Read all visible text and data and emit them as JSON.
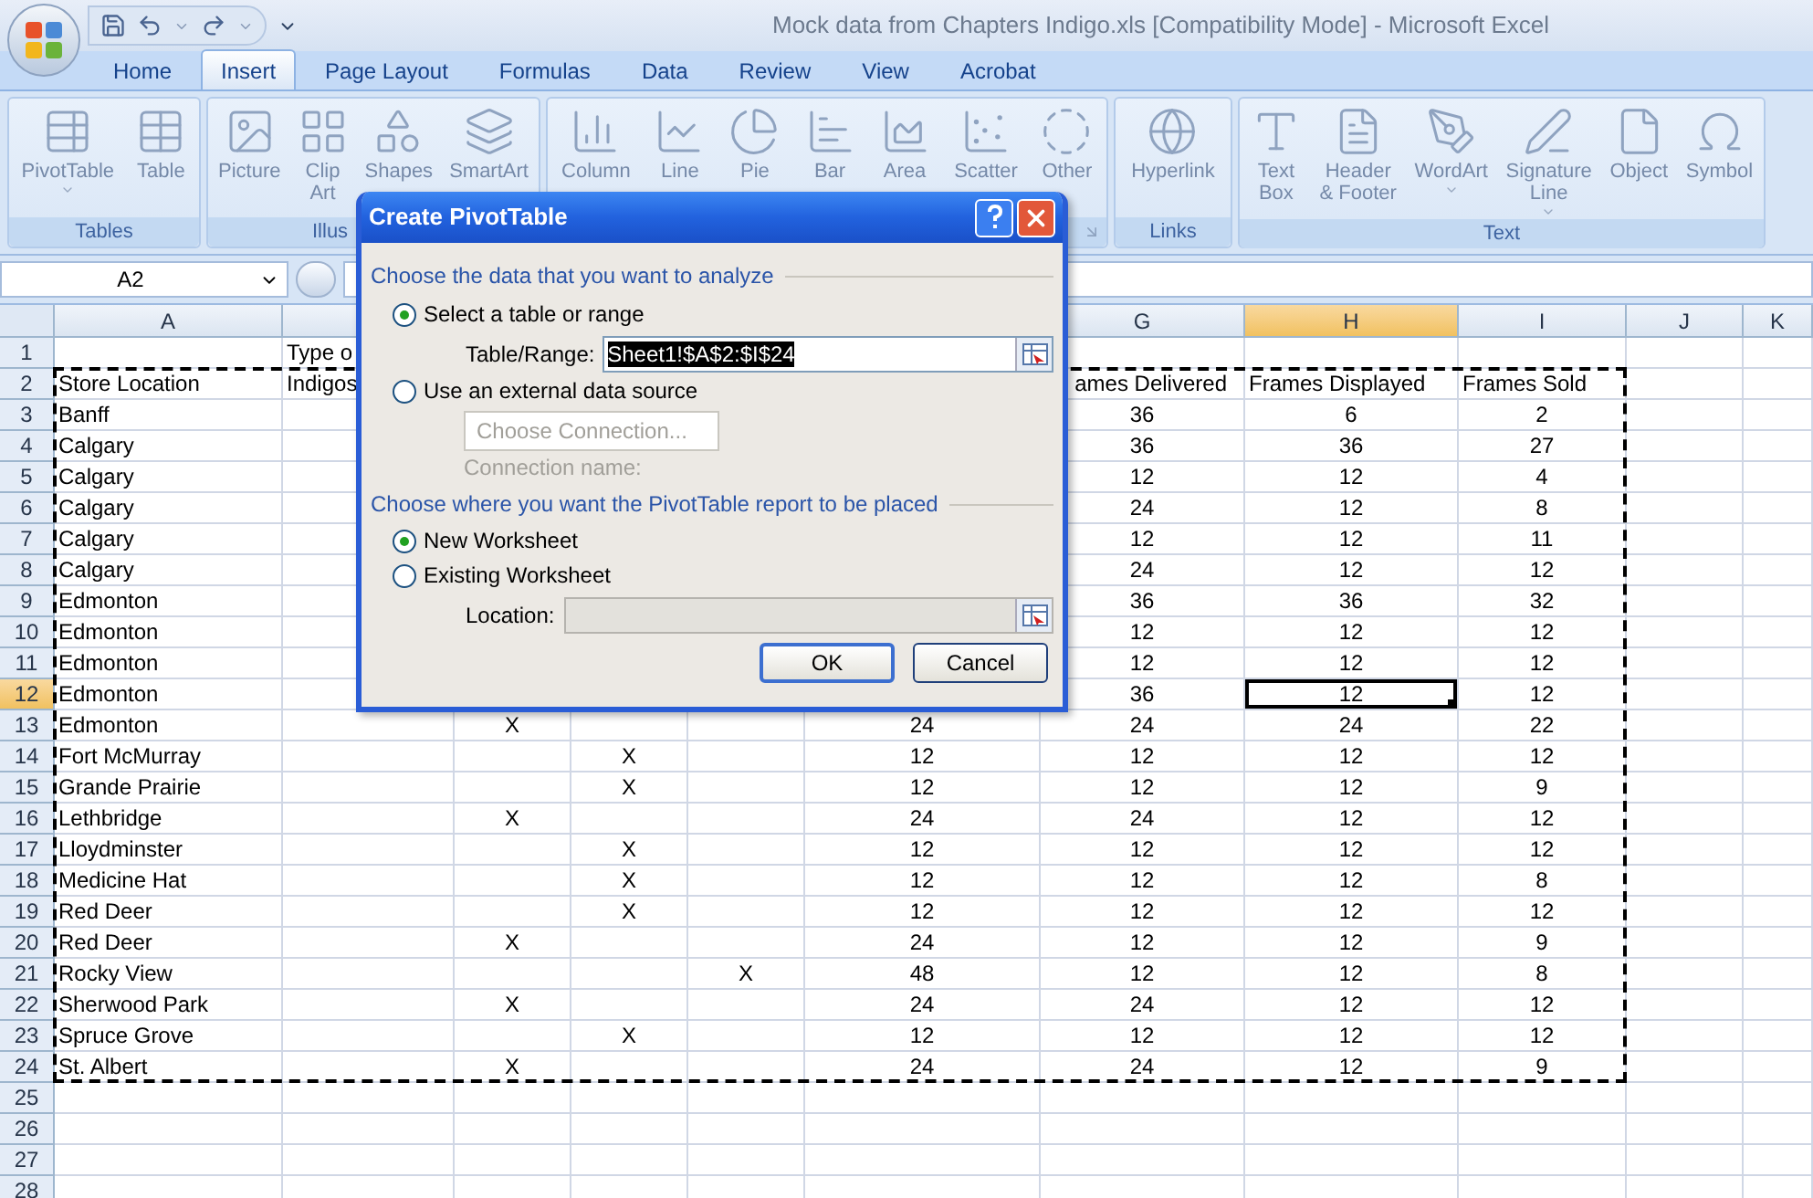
{
  "window": {
    "title": "Mock data from Chapters Indigo.xls  [Compatibility Mode] - Microsoft Excel"
  },
  "tabs": [
    {
      "label": "Home",
      "selected": false
    },
    {
      "label": "Insert",
      "selected": true
    },
    {
      "label": "Page Layout",
      "selected": false
    },
    {
      "label": "Formulas",
      "selected": false
    },
    {
      "label": "Data",
      "selected": false
    },
    {
      "label": "Review",
      "selected": false
    },
    {
      "label": "View",
      "selected": false
    },
    {
      "label": "Acrobat",
      "selected": false
    }
  ],
  "ribbon": {
    "groups": [
      {
        "label": "Tables",
        "buttons": [
          {
            "label": [
              "PivotTable"
            ],
            "dropdown": true
          },
          {
            "label": [
              "Table"
            ],
            "dropdown": false
          }
        ]
      },
      {
        "label": "Illus",
        "buttons": [
          {
            "label": [
              "Picture"
            ],
            "dropdown": false
          },
          {
            "label": [
              "Clip",
              "Art"
            ],
            "dropdown": false
          },
          {
            "label": [
              "Shapes"
            ],
            "dropdown": false
          },
          {
            "label": [
              "SmartArt"
            ],
            "dropdown": false
          }
        ]
      },
      {
        "launcher": true,
        "buttons": [
          {
            "label": [
              "Column"
            ],
            "dropdown": false
          },
          {
            "label": [
              "Line"
            ],
            "dropdown": false
          },
          {
            "label": [
              "Pie"
            ],
            "dropdown": false
          },
          {
            "label": [
              "Bar"
            ],
            "dropdown": false
          },
          {
            "label": [
              "Area"
            ],
            "dropdown": false
          },
          {
            "label": [
              "Scatter"
            ],
            "dropdown": false
          },
          {
            "label": [
              "Other"
            ],
            "dropdown": false
          }
        ]
      },
      {
        "label": "Links",
        "buttons": [
          {
            "label": [
              "Hyperlink"
            ],
            "dropdown": false
          }
        ]
      },
      {
        "label": "Text",
        "buttons": [
          {
            "label": [
              "Text",
              "Box"
            ],
            "dropdown": false
          },
          {
            "label": [
              "Header",
              "& Footer"
            ],
            "dropdown": false
          },
          {
            "label": [
              "WordArt"
            ],
            "dropdown": true
          },
          {
            "label": [
              "Signature",
              "Line"
            ],
            "dropdown": true
          },
          {
            "label": [
              "Object"
            ],
            "dropdown": false
          },
          {
            "label": [
              "Symbol"
            ],
            "dropdown": false
          }
        ]
      }
    ]
  },
  "name_box": {
    "value": "A2"
  },
  "sheet": {
    "copy_marquee": true,
    "columns": [
      {
        "label": "A",
        "selected": false
      },
      {},
      {},
      {},
      {},
      {},
      {
        "label": "G",
        "selected": false
      },
      {
        "label": "H",
        "selected": true
      },
      {
        "label": "I",
        "selected": false
      },
      {
        "label": "J",
        "selected": false
      },
      {
        "label": "K",
        "selected": false
      }
    ],
    "rows": [
      {
        "number": "1",
        "selected": false,
        "kind": "label",
        "cells": [
          null,
          "Type o"
        ]
      },
      {
        "number": "2",
        "selected": false,
        "kind": "label",
        "cells": [
          "Store Location",
          "Indigos",
          null,
          null,
          null,
          null,
          "ames Delivered",
          "Frames Displayed",
          "Frames Sold"
        ]
      },
      {
        "number": "3",
        "selected": false,
        "kind": "record",
        "cells": [
          "Banff",
          null,
          null,
          null,
          null,
          null,
          "36",
          "6",
          "2"
        ]
      },
      {
        "number": "4",
        "selected": false,
        "kind": "record",
        "cells": [
          "Calgary",
          null,
          null,
          null,
          null,
          null,
          "36",
          "36",
          "27"
        ]
      },
      {
        "number": "5",
        "selected": false,
        "kind": "record",
        "cells": [
          "Calgary",
          null,
          null,
          null,
          null,
          null,
          "12",
          "12",
          "4"
        ]
      },
      {
        "number": "6",
        "selected": false,
        "kind": "record",
        "cells": [
          "Calgary",
          null,
          null,
          null,
          null,
          null,
          "24",
          "12",
          "8"
        ]
      },
      {
        "number": "7",
        "selected": false,
        "kind": "record",
        "cells": [
          "Calgary",
          null,
          null,
          null,
          null,
          null,
          "12",
          "12",
          "11"
        ]
      },
      {
        "number": "8",
        "selected": false,
        "kind": "record",
        "cells": [
          "Calgary",
          null,
          null,
          null,
          null,
          null,
          "24",
          "12",
          "12"
        ]
      },
      {
        "number": "9",
        "selected": false,
        "kind": "record",
        "cells": [
          "Edmonton",
          null,
          null,
          null,
          null,
          null,
          "36",
          "36",
          "32"
        ]
      },
      {
        "number": "10",
        "selected": false,
        "kind": "record",
        "cells": [
          "Edmonton",
          null,
          null,
          null,
          null,
          null,
          "12",
          "12",
          "12"
        ]
      },
      {
        "number": "11",
        "selected": false,
        "kind": "record",
        "cells": [
          "Edmonton",
          null,
          null,
          null,
          null,
          null,
          "12",
          "12",
          "12"
        ]
      },
      {
        "number": "12",
        "selected": true,
        "kind": "record",
        "cells": [
          "Edmonton",
          null,
          null,
          null,
          null,
          null,
          "36",
          "12",
          "12"
        ]
      },
      {
        "number": "13",
        "selected": false,
        "kind": "record",
        "cells": [
          "Edmonton",
          null,
          "X",
          null,
          null,
          "24",
          "24",
          "24",
          "22"
        ]
      },
      {
        "number": "14",
        "selected": false,
        "kind": "record",
        "cells": [
          "Fort McMurray",
          null,
          null,
          "X",
          null,
          "12",
          "12",
          "12",
          "12"
        ]
      },
      {
        "number": "15",
        "selected": false,
        "kind": "record",
        "cells": [
          "Grande Prairie",
          null,
          null,
          "X",
          null,
          "12",
          "12",
          "12",
          "9"
        ]
      },
      {
        "number": "16",
        "selected": false,
        "kind": "record",
        "cells": [
          "Lethbridge",
          null,
          "X",
          null,
          null,
          "24",
          "24",
          "12",
          "12"
        ]
      },
      {
        "number": "17",
        "selected": false,
        "kind": "record",
        "cells": [
          "Lloydminster",
          null,
          null,
          "X",
          null,
          "12",
          "12",
          "12",
          "12"
        ]
      },
      {
        "number": "18",
        "selected": false,
        "kind": "record",
        "cells": [
          "Medicine Hat",
          null,
          null,
          "X",
          null,
          "12",
          "12",
          "12",
          "8"
        ]
      },
      {
        "number": "19",
        "selected": false,
        "kind": "record",
        "cells": [
          "Red Deer",
          null,
          null,
          "X",
          null,
          "12",
          "12",
          "12",
          "12"
        ]
      },
      {
        "number": "20",
        "selected": false,
        "kind": "record",
        "cells": [
          "Red Deer",
          null,
          "X",
          null,
          null,
          "24",
          "12",
          "12",
          "9"
        ]
      },
      {
        "number": "21",
        "selected": false,
        "kind": "record",
        "cells": [
          "Rocky View",
          null,
          null,
          null,
          "X",
          "48",
          "12",
          "12",
          "8"
        ]
      },
      {
        "number": "22",
        "selected": false,
        "kind": "record",
        "cells": [
          "Sherwood Park",
          null,
          "X",
          null,
          null,
          "24",
          "24",
          "12",
          "12"
        ]
      },
      {
        "number": "23",
        "selected": false,
        "kind": "record",
        "cells": [
          "Spruce Grove",
          null,
          null,
          "X",
          null,
          "12",
          "12",
          "12",
          "12"
        ]
      },
      {
        "number": "24",
        "selected": false,
        "kind": "record",
        "cells": [
          "St. Albert",
          null,
          "X",
          null,
          null,
          "24",
          "24",
          "12",
          "9"
        ]
      },
      {
        "number": "25",
        "selected": false,
        "kind": "record",
        "cells": []
      },
      {
        "number": "26",
        "selected": false,
        "kind": "record",
        "cells": []
      },
      {
        "number": "27",
        "selected": false,
        "kind": "record",
        "cells": []
      },
      {
        "number": "28",
        "selected": false,
        "kind": "record",
        "cells": []
      }
    ]
  },
  "dialog": {
    "title": "Create PivotTable",
    "section_1": "Choose the data that you want to analyze",
    "source_options": [
      {
        "label": "Select a table or range",
        "selected": true
      },
      {
        "label": "Use an external data source",
        "selected": false
      }
    ],
    "range_label": "Table/Range:",
    "range_value": "Sheet1!$A$2:$I$24",
    "connection_button": {
      "label": "Choose Connection...",
      "disabled": true
    },
    "connection_name": {
      "label": "Connection name:",
      "disabled": true
    },
    "section_2": "Choose where you want the PivotTable report to be placed",
    "placement_options": [
      {
        "label": "New Worksheet",
        "selected": true
      },
      {
        "label": "Existing Worksheet",
        "selected": false
      }
    ],
    "location_label": "Location:",
    "location_disabled": true,
    "buttons": [
      {
        "label": "OK",
        "default": true
      },
      {
        "label": "Cancel",
        "default": false
      }
    ]
  }
}
